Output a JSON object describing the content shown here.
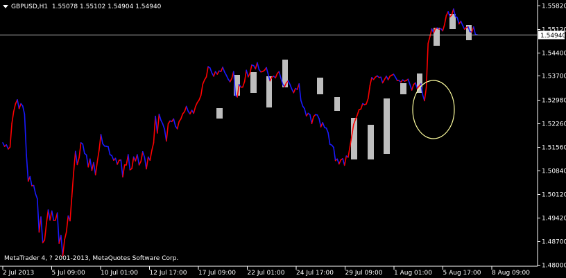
{
  "header": {
    "symbol": "GBPUSD,H1",
    "open": "1.55078",
    "high": "1.55102",
    "low": "1.54904",
    "close": "1.54940"
  },
  "footer": {
    "copyright": "MetaTrader 4, ? 2001-2013, MetaQuotes Software Corp."
  },
  "colors": {
    "background": "#000000",
    "bull": "#ff0000",
    "bear": "#1a1aff",
    "axis": "#ffffff",
    "highlight": "#c8c8c8",
    "annotation": "#ffffa0",
    "current_price_line": "#c0c0c0"
  },
  "chart_data": {
    "type": "line",
    "symbol": "GBPUSD",
    "timeframe": "H1",
    "current_price": 1.5494,
    "current_price_label": "1.54940",
    "ylim": [
      1.4795,
      1.5595
    ],
    "yticks": [
      "1.55820",
      "1.55120",
      "1.54400",
      "1.53700",
      "1.52980",
      "1.52260",
      "1.51560",
      "1.50840",
      "1.50120",
      "1.49420",
      "1.48700",
      "1.48000"
    ],
    "xticks": [
      "2 Jul 2013",
      "5 Jul 09:00",
      "10 Jul 01:00",
      "12 Jul 17:00",
      "17 Jul 09:00",
      "22 Jul 01:00",
      "24 Jul 17:00",
      "29 Jul 09:00",
      "1 Aug 01:00",
      "5 Aug 17:00",
      "8 Aug 09:00"
    ],
    "series": [
      {
        "values": [
          1.5168,
          1.5157,
          1.5162,
          1.5149,
          1.5155,
          1.5226,
          1.5262,
          1.5285,
          1.5298,
          1.5271,
          1.5286,
          1.5279,
          1.5254,
          1.5131,
          1.5052,
          1.5066,
          1.5038,
          1.5039,
          1.5014,
          1.4999,
          1.4898,
          1.4944,
          1.4866,
          1.4874,
          1.4923,
          1.4965,
          1.4934,
          1.4962,
          1.4933,
          1.4934,
          1.4956,
          1.4864,
          1.4888,
          1.4826,
          1.4875,
          1.4898,
          1.4947,
          1.4932,
          1.5006,
          1.5079,
          1.5142,
          1.5102,
          1.5123,
          1.5168,
          1.5164,
          1.5136,
          1.5131,
          1.5095,
          1.5119,
          1.5084,
          1.5108,
          1.5071,
          1.5111,
          1.5146,
          1.5193,
          1.5165,
          1.5158,
          1.5157,
          1.5156,
          1.5132,
          1.5129,
          1.5115,
          1.5121,
          1.5103,
          1.5115,
          1.5116,
          1.5065,
          1.5101,
          1.5101,
          1.5132,
          1.5086,
          1.509,
          1.5125,
          1.5113,
          1.5132,
          1.5101,
          1.5112,
          1.5141,
          1.5124,
          1.5089,
          1.5125,
          1.5115,
          1.5145,
          1.5168,
          1.5248,
          1.5197,
          1.5254,
          1.5236,
          1.5225,
          1.5209,
          1.5173,
          1.5225,
          1.5234,
          1.5232,
          1.524,
          1.5218,
          1.521,
          1.5232,
          1.524,
          1.5255,
          1.5262,
          1.5278,
          1.5263,
          1.5255,
          1.5266,
          1.5257,
          1.5277,
          1.5289,
          1.5297,
          1.5311,
          1.5345,
          1.5358,
          1.5367,
          1.5398,
          1.5394,
          1.5379,
          1.5369,
          1.5383,
          1.5375,
          1.5385,
          1.5383,
          1.5396,
          1.5382,
          1.5372,
          1.536,
          1.5352,
          1.5362,
          1.5383,
          1.5311,
          1.5306,
          1.5344,
          1.5336,
          1.5336,
          1.5353,
          1.5387,
          1.5367,
          1.5378,
          1.5403,
          1.5401,
          1.5391,
          1.541,
          1.5389,
          1.5382,
          1.5383,
          1.5387,
          1.5395,
          1.5375,
          1.5355,
          1.5366,
          1.5369,
          1.5364,
          1.5377,
          1.5383,
          1.5363,
          1.5345,
          1.5337,
          1.5349,
          1.5355,
          1.5344,
          1.533,
          1.5319,
          1.5332,
          1.5329,
          1.5346,
          1.5296,
          1.5279,
          1.5271,
          1.5249,
          1.5257,
          1.5253,
          1.5226,
          1.5247,
          1.5253,
          1.5252,
          1.5241,
          1.5216,
          1.5229,
          1.5214,
          1.5212,
          1.5198,
          1.5163,
          1.5161,
          1.5154,
          1.5114,
          1.5119,
          1.5104,
          1.5116,
          1.512,
          1.51,
          1.5128,
          1.5124,
          1.5157,
          1.5189,
          1.5223,
          1.5238,
          1.5251,
          1.5268,
          1.527,
          1.5286,
          1.5283,
          1.5285,
          1.5302,
          1.5341,
          1.5365,
          1.5359,
          1.5366,
          1.537,
          1.5365,
          1.5366,
          1.5349,
          1.5359,
          1.5369,
          1.5358,
          1.5369,
          1.5372,
          1.5375,
          1.5366,
          1.5356,
          1.5356,
          1.5351,
          1.5358,
          1.5354,
          1.5356,
          1.536,
          1.5344,
          1.5327,
          1.5344,
          1.5349,
          1.5332,
          1.5339,
          1.5346,
          1.5313,
          1.5295,
          1.5335,
          1.5468,
          1.5489,
          1.5512,
          1.55,
          1.5513,
          1.5515,
          1.5511,
          1.5513,
          1.5506,
          1.5524,
          1.5552,
          1.5564,
          1.5548,
          1.5554,
          1.5572,
          1.5549,
          1.5546,
          1.5527,
          1.5535,
          1.5523,
          1.5511,
          1.5516,
          1.5518,
          1.5504,
          1.5502,
          1.5518,
          1.5495,
          1.5494
        ]
      }
    ]
  }
}
